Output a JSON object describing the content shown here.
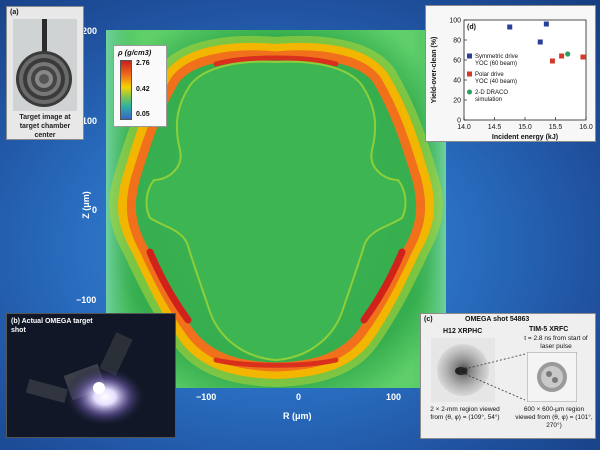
{
  "colors": {
    "map_bg": "#2fb34e",
    "shell_outer": "#f2b400",
    "shell_inner": "#e6451e",
    "shell_core": "#c9201c"
  },
  "main_plot": {
    "ylabel": "Z (μm)",
    "xlabel": "R (μm)",
    "y_ticks": [
      "200",
      "100",
      "0",
      "−100"
    ],
    "x_ticks": [
      "−100",
      "0",
      "100"
    ]
  },
  "colorbar": {
    "title": "ρ (g/cm3)",
    "max": "2.76",
    "mid": "0.42",
    "min": "0.05"
  },
  "panel_a": {
    "tag": "(a)",
    "caption": "Target image at target chamber center"
  },
  "panel_b": {
    "caption": "(b) Actual OMEGA target shot"
  },
  "panel_c": {
    "tag": "(c)",
    "shot": "OMEGA shot 54863",
    "left_title": "H12 XRPHC",
    "left_caption": "2 × 2-mm region viewed from (θ, φ) = (109°, 54°)",
    "right_title": "TIM-5 XRFC",
    "right_sub": "t = 2.8 ns from start of laser pulse",
    "right_caption": "600 × 600-μm region viewed from (θ, φ) = (101°, 270°)"
  },
  "chart_data": {
    "type": "scatter",
    "tag": "(d)",
    "xlabel": "Incident energy (kJ)",
    "ylabel": "Yield-over-clean (%)",
    "xlim": [
      14.0,
      16.0
    ],
    "ylim": [
      0,
      100
    ],
    "x_ticks": [
      "14.0",
      "14.5",
      "15.0",
      "15.5",
      "16.0"
    ],
    "y_ticks": [
      "0",
      "20",
      "40",
      "60",
      "80",
      "100"
    ],
    "legend": "top-left",
    "series": [
      {
        "name": "Symmetric drive YOC (60 beam)",
        "color": "#2b3f99",
        "marker": "square",
        "points": [
          [
            14.75,
            93
          ],
          [
            15.25,
            78
          ],
          [
            15.35,
            96
          ]
        ]
      },
      {
        "name": "Polar drive YOC (40 beam)",
        "color": "#d23a2a",
        "marker": "square",
        "points": [
          [
            15.45,
            59
          ],
          [
            15.6,
            64
          ],
          [
            15.95,
            63
          ]
        ]
      },
      {
        "name": "2-D DRACO simulation",
        "color": "#2aa060",
        "marker": "circle",
        "points": [
          [
            15.7,
            66
          ]
        ]
      }
    ]
  }
}
